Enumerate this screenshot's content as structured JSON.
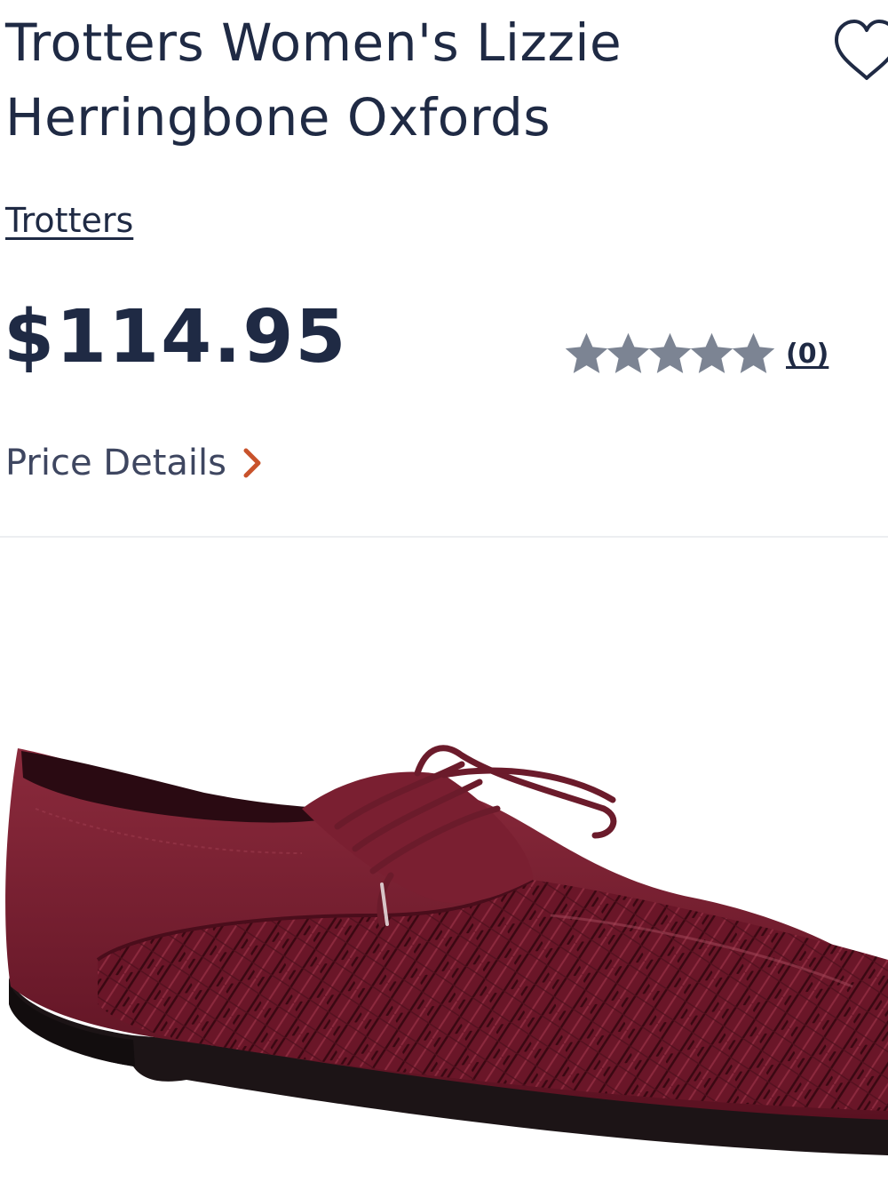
{
  "product": {
    "title": "Trotters Women's Lizzie Herringbone Oxfords",
    "brand": "Trotters",
    "price": "$114.95",
    "rating": {
      "stars_filled": 0,
      "stars_total": 5,
      "review_count_label": "(0)"
    },
    "price_details_label": "Price Details",
    "wishlist_icon": "heart-outline-icon",
    "image": {
      "subject": "burgundy herringbone woven leather lace-up oxford shoe"
    }
  },
  "colors": {
    "text": "#1f2a44",
    "star": "#7c8493",
    "chevron_accent": "#c8522b",
    "shoe_leather": "#6e1a2c",
    "sole": "#1c1416"
  }
}
